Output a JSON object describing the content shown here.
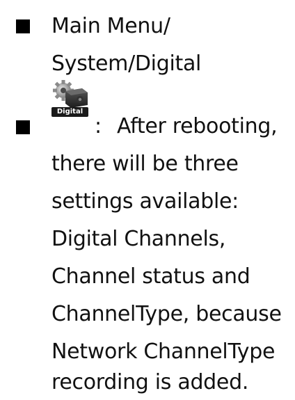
{
  "items": [
    {
      "lines": [
        "Main Menu/",
        "System/Digital"
      ]
    },
    {
      "icon": {
        "name": "digital-settings-icon",
        "label": "Digital"
      },
      "colon": ":",
      "first_line": "After rebooting,",
      "lines": [
        "there will be three",
        "settings available:",
        "Digital Channels,",
        "Channel status and",
        "ChannelType, because",
        "Network ChannelType",
        "recording is added."
      ]
    }
  ]
}
